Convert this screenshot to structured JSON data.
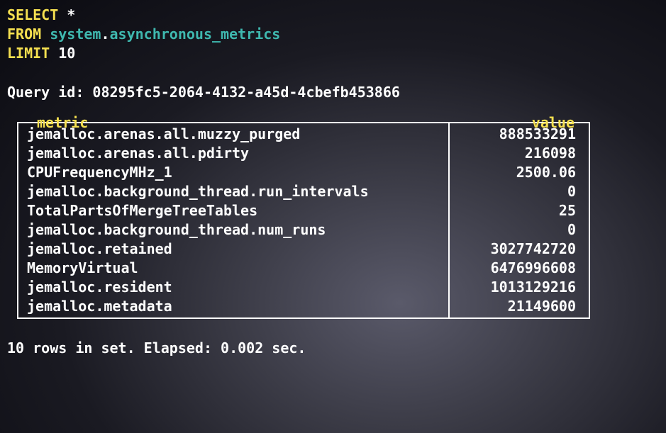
{
  "query": {
    "select": "SELECT",
    "star": " *",
    "from": "FROM",
    "table": " system",
    "dot": ".",
    "table2": "asynchronous_metrics",
    "limit": "LIMIT",
    "limit_n": " 10"
  },
  "query_id_label": "Query id: ",
  "query_id": "08295fc5-2064-4132-a45d-4cbefb453866",
  "headers": {
    "metric": "metric",
    "value": "value"
  },
  "rows": [
    {
      "metric": "jemalloc.arenas.all.muzzy_purged",
      "value": "888533291"
    },
    {
      "metric": "jemalloc.arenas.all.pdirty",
      "value": "216098"
    },
    {
      "metric": "CPUFrequencyMHz_1",
      "value": "2500.06"
    },
    {
      "metric": "jemalloc.background_thread.run_intervals",
      "value": "0"
    },
    {
      "metric": "TotalPartsOfMergeTreeTables",
      "value": "25"
    },
    {
      "metric": "jemalloc.background_thread.num_runs",
      "value": "0"
    },
    {
      "metric": "jemalloc.retained",
      "value": "3027742720"
    },
    {
      "metric": "MemoryVirtual",
      "value": "6476996608"
    },
    {
      "metric": "jemalloc.resident",
      "value": "1013129216"
    },
    {
      "metric": "jemalloc.metadata",
      "value": "21149600"
    }
  ],
  "footer": "10 rows in set. Elapsed: 0.002 sec."
}
